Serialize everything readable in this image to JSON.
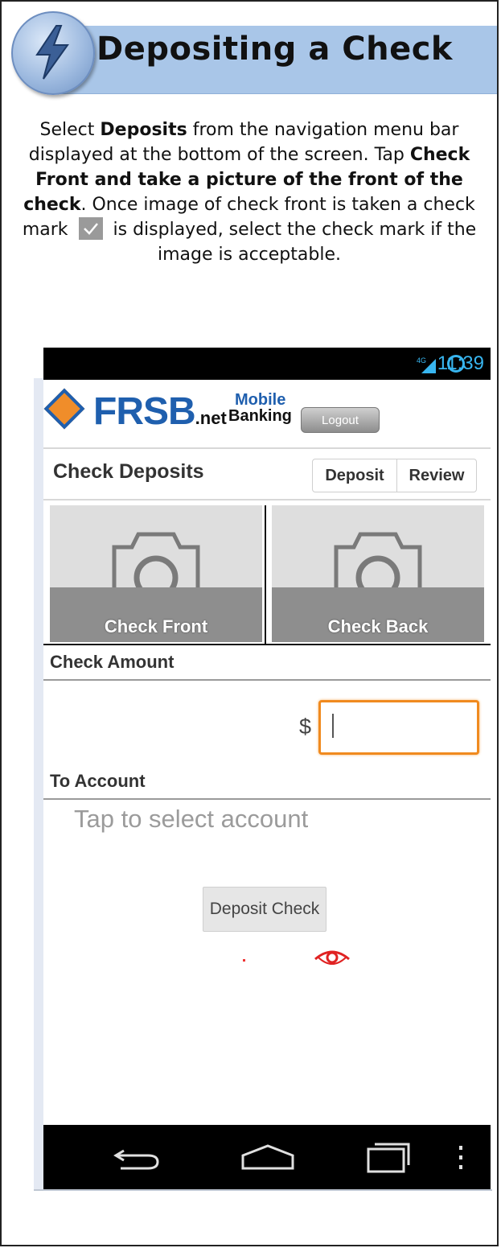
{
  "header": {
    "title": "Depositing a Check",
    "badge_icon": "lightning-bolt-icon"
  },
  "instructions": {
    "p1": "Select ",
    "b1": "Deposits",
    "p2": " from the navigation menu bar displayed at the bottom of the screen. Tap ",
    "b2": "Check Front and take a picture of the front of the check",
    "p3": ". Once image of check front is taken a check mark ",
    "p4": " is displayed, select the check mark if the image is acceptable."
  },
  "status_bar": {
    "network": "4G",
    "time": "11:39"
  },
  "app": {
    "logo_main": "FRSB",
    "logo_suffix": ".net",
    "logo_mobile": "Mobile",
    "logo_banking": "Banking",
    "logout_label": "Logout",
    "page_title": "Check Deposits",
    "tabs": [
      "Deposit",
      "Review"
    ],
    "check_front_label": "Check Front",
    "check_back_label": "Check Back",
    "check_amount_label": "Check Amount",
    "currency_symbol": "$",
    "amount_value": "",
    "to_account_label": "To Account",
    "account_placeholder": "Tap to select account",
    "deposit_button_label": "Deposit Check"
  },
  "colors": {
    "header_band": "#a9c6e8",
    "brand_blue": "#1f5fae",
    "brand_orange": "#f08d2a",
    "input_focus": "#f08a1f",
    "status_blue": "#38b6f0"
  },
  "icons": [
    "lightning-bolt-icon",
    "checkmark-icon",
    "signal-icon",
    "sync-icon",
    "camera-icon",
    "back-icon",
    "home-icon",
    "recent-apps-icon",
    "overflow-menu-icon",
    "red-eye-glyph-icon"
  ]
}
